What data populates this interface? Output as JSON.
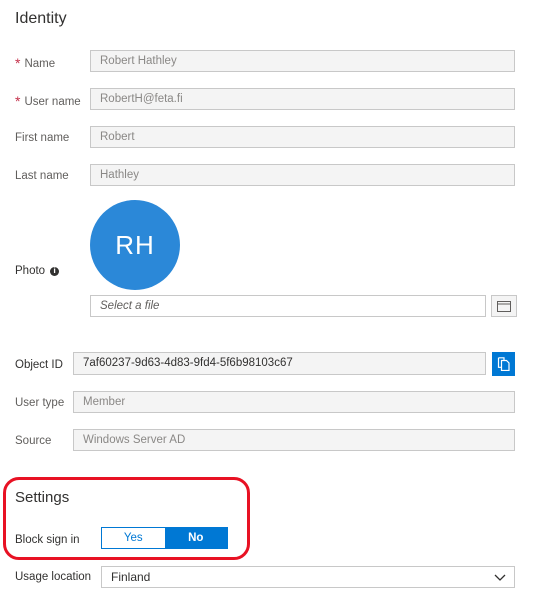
{
  "identity": {
    "heading": "Identity",
    "name_label": "Name",
    "name_value": "Robert Hathley",
    "username_label": "User name",
    "username_value": "RobertH@feta.fi",
    "firstname_label": "First name",
    "firstname_value": "Robert",
    "lastname_label": "Last name",
    "lastname_value": "Hathley",
    "photo_label": "Photo",
    "photo_initials": "RH",
    "photo_info_glyph": "i",
    "file_placeholder": "Select a file",
    "objectid_label": "Object ID",
    "objectid_value": "7af60237-9d63-4d83-9fd4-5f6b98103c67",
    "usertype_label": "User type",
    "usertype_value": "Member",
    "source_label": "Source",
    "source_value": "Windows Server AD",
    "required_marker": "*"
  },
  "settings": {
    "heading": "Settings",
    "block_label": "Block sign in",
    "yes_label": "Yes",
    "no_label": "No",
    "selected": "No",
    "usage_label": "Usage location",
    "usage_value": "Finland"
  },
  "colors": {
    "accent": "#0078d4",
    "avatar": "#2b88d8",
    "required": "#c4314b",
    "highlight": "#e81123"
  },
  "icons": {
    "browse": "folder-icon",
    "copy": "copy-icon",
    "info": "info-icon",
    "dropdown": "chevron-down-icon"
  }
}
